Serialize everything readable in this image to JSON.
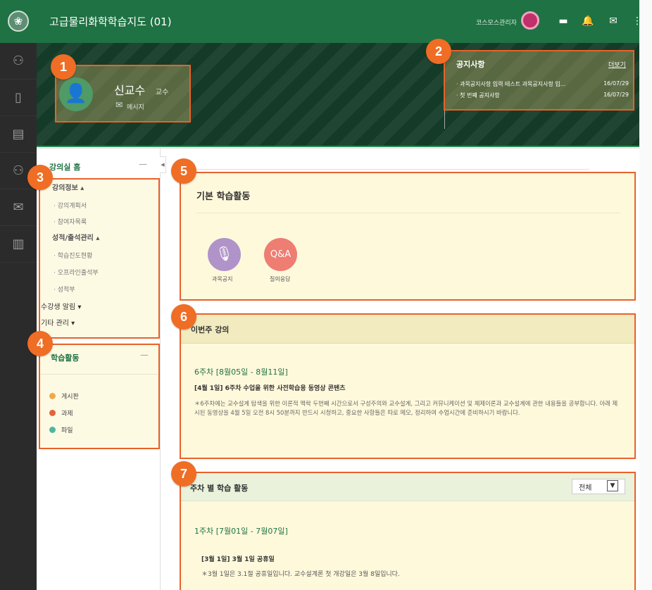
{
  "header": {
    "logo_glyph": "❀",
    "course_title": "고급물리화학학습지도 (01)",
    "admin_name": "코스모스관리자",
    "icons": [
      {
        "name": "window-icon",
        "glyph": "▬"
      },
      {
        "name": "bell-icon",
        "glyph": "🔔"
      },
      {
        "name": "mail-icon",
        "glyph": "✉"
      },
      {
        "name": "apps-grid-icon",
        "glyph": "⋮⋮"
      }
    ]
  },
  "rail": {
    "icons": [
      {
        "name": "people-icon",
        "glyph": "⚇"
      },
      {
        "name": "notebook-icon",
        "glyph": "▯"
      },
      {
        "name": "board-icon",
        "glyph": "▤"
      },
      {
        "name": "group-icon",
        "glyph": "⚇"
      },
      {
        "name": "mail-icon",
        "glyph": "✉"
      },
      {
        "name": "map-icon",
        "glyph": "▥"
      }
    ]
  },
  "profile": {
    "name": "신교수",
    "role": "교수",
    "message_label": "메시지"
  },
  "notice": {
    "title": "공지사항",
    "more": "더보기",
    "items": [
      {
        "text": "· 과목공지사항 입력 테스트 과목공지사항 입...",
        "date": "16/07/29"
      },
      {
        "text": "· 첫 번째 공지사항",
        "date": "16/07/29"
      }
    ]
  },
  "sidebar": {
    "home": "강의실 홈",
    "menu": [
      {
        "label": "강의정보 ▴",
        "kind": "head"
      },
      {
        "label": "· 강의계획서",
        "kind": "sub"
      },
      {
        "label": "· 참여자목록",
        "kind": "sub"
      },
      {
        "label": "성적/출석관리 ▴",
        "kind": "head"
      },
      {
        "label": "· 학습진도현황",
        "kind": "sub"
      },
      {
        "label": "· 오프라인출석부",
        "kind": "sub"
      },
      {
        "label": "· 성적부",
        "kind": "sub"
      },
      {
        "label": "수강생 알림 ▾",
        "kind": "item"
      },
      {
        "label": "기타 관리 ▾",
        "kind": "item"
      }
    ],
    "activity_title": "학습활동",
    "activities": [
      {
        "label": "게시판",
        "color": "#f0a94a"
      },
      {
        "label": "과제",
        "color": "#e3633c"
      },
      {
        "label": "파일",
        "color": "#4db6a2"
      }
    ]
  },
  "basic": {
    "title": "기본 학습활동",
    "items": [
      {
        "label": "과목공지",
        "icon": "🎙"
      },
      {
        "label": "질의응답",
        "icon": "Q&A"
      }
    ]
  },
  "this_week": {
    "title": "이번주 강의",
    "range": "6주차 [8월05일 - 8월11일]",
    "item_title": "[4월 1일] 6주차 수업을 위한 사전학습용 동영상 콘텐츠",
    "item_desc": "＊6주차에는 교수설계 탐색을 위한 이론적 맥락 두번째 시간으로서 구성주의와 교수설계, 그리고 커뮤니케이션 및 체제이론과 교수설계에 관한 내용들을 공부합니다. 아래 제시된 동영상을 4월 5일 오전 8시 50분까지 반드시 시청하고, 중요한 사항들은 따로 메모, 정리하여 수업시간에 준비하시기 바랍니다."
  },
  "weekly": {
    "title": "주차 별 학습 활동",
    "filter": "전체",
    "range": "1주차 [7월01일 - 7월07일]",
    "item_title": "[3월 1일] 3월 1일 공휴일",
    "item_desc": "＊3월 1일은 3.1절 공휴일입니다.  교수설계론 첫 개강일은 3월 8일입니다."
  },
  "badges": [
    "1",
    "2",
    "3",
    "4",
    "5",
    "6",
    "7"
  ]
}
